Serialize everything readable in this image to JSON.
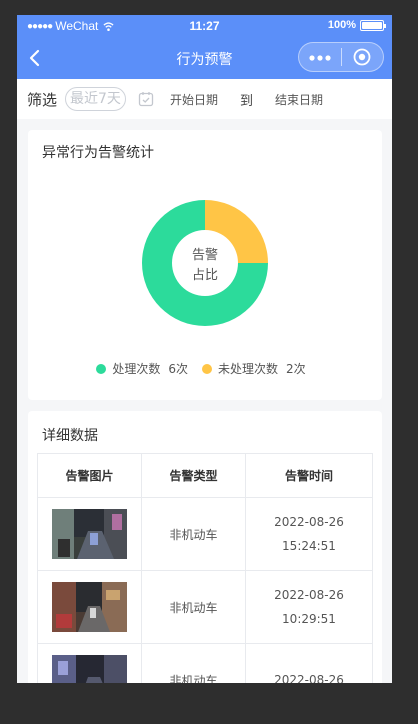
{
  "status_bar": {
    "carrier": "WeChat",
    "signal_dots": "●●●●●",
    "time": "11:27",
    "battery": "100%"
  },
  "navbar": {
    "title": "行为预警",
    "more_icon": "more-dots-icon",
    "target_icon": "target-icon",
    "back_icon": "back-chevron-icon"
  },
  "filter": {
    "label": "筛选",
    "quick_range": "最近7天",
    "start_placeholder": "开始日期",
    "to_label": "到",
    "end_placeholder": "结束日期"
  },
  "stats_card": {
    "title": "异常行为告警统计",
    "donut_center_line1": "告警",
    "donut_center_line2": "占比"
  },
  "chart_data": {
    "type": "pie",
    "series": [
      {
        "name": "处理次数",
        "value": 6,
        "color": "#2cdb9b"
      },
      {
        "name": "未处理次数",
        "value": 2,
        "color": "#ffc546"
      }
    ],
    "legend": [
      {
        "name": "处理次数",
        "count": "6次",
        "color": "#2cdb9b"
      },
      {
        "name": "未处理次数",
        "count": "2次",
        "color": "#ffc546"
      }
    ],
    "legend_position": "bottom"
  },
  "detail_card": {
    "title": "详细数据",
    "columns": [
      "告警图片",
      "告警类型",
      "告警时间"
    ],
    "rows": [
      {
        "type": "非机动车",
        "date": "2022-08-26",
        "time": "15:24:51"
      },
      {
        "type": "非机动车",
        "date": "2022-08-26",
        "time": "10:29:51"
      },
      {
        "type": "非机动车",
        "date": "2022-08-26",
        "time": ""
      }
    ]
  },
  "colors": {
    "primary": "#5b8ff9",
    "processed": "#2cdb9b",
    "unprocessed": "#ffc546"
  }
}
